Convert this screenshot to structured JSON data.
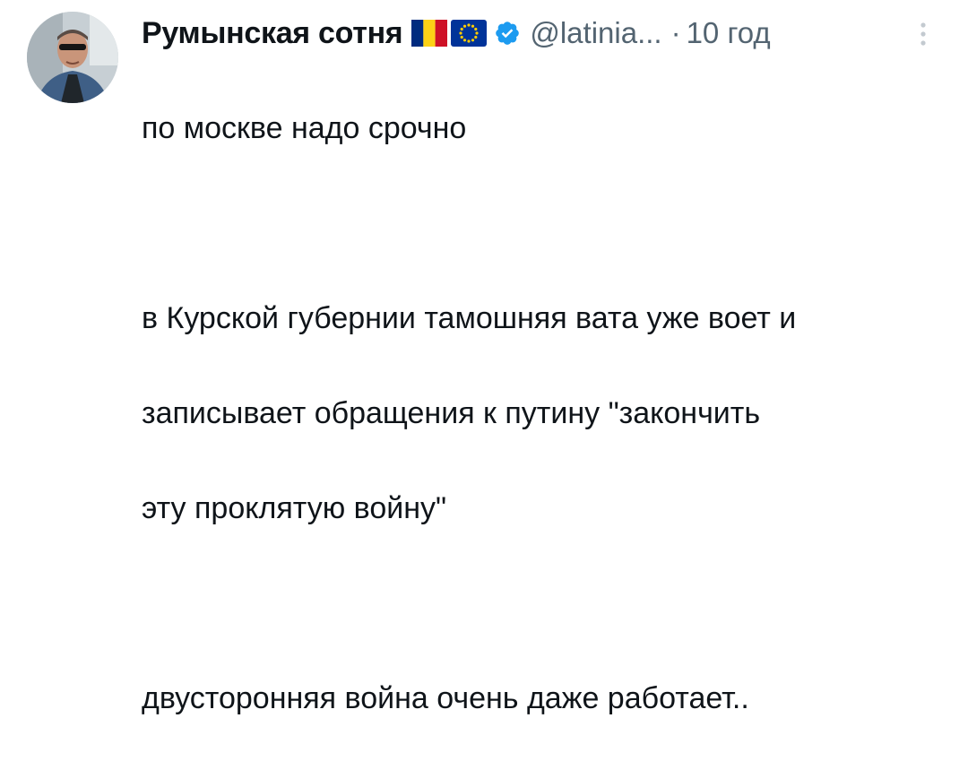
{
  "tweet": {
    "display_name": "Румынская сотня",
    "handle": "@latinia...",
    "separator": "·",
    "time": "10 год",
    "avatar_icon": "profile-photo",
    "flag_icons": [
      "romania-flag-icon",
      "eu-flag-icon"
    ],
    "verified_icon": "verified-badge-icon",
    "more_icon": "more-vertical-icon",
    "lines": [
      "по москве надо срочно",
      "",
      "в Курской губернии тамошняя вата уже воет и",
      "записывает обращения к путину \"закончить",
      "эту проклятую войну\"",
      "",
      "двусторонняя война очень даже работает.."
    ]
  },
  "colors": {
    "text_primary": "#0f1419",
    "text_secondary": "#536471",
    "verified_blue": "#1d9bf0",
    "romania_blue": "#002b7f",
    "romania_yellow": "#fcd116",
    "romania_red": "#ce1126",
    "eu_blue": "#003399",
    "eu_gold": "#ffcc00"
  }
}
